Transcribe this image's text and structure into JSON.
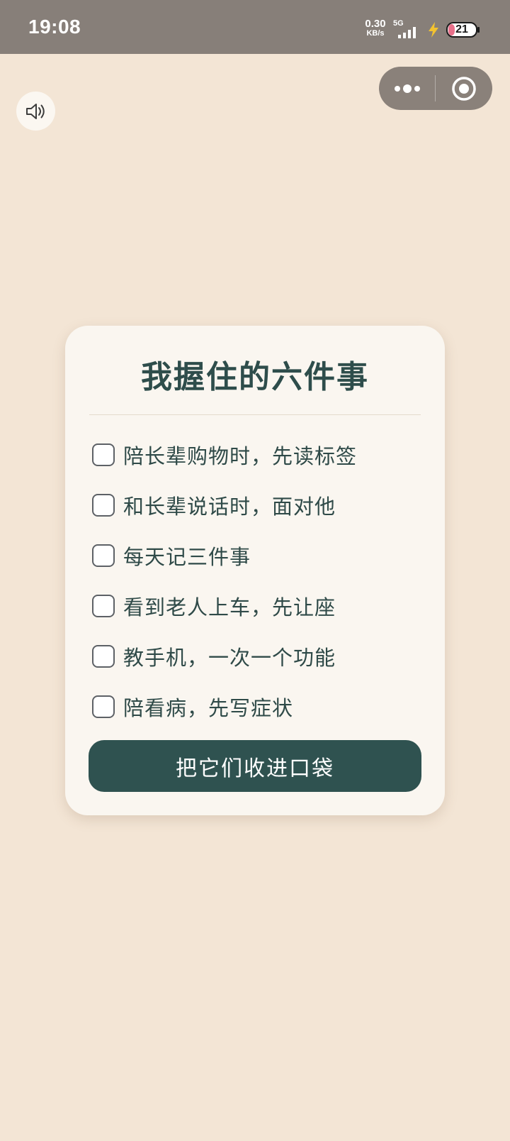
{
  "status_bar": {
    "time": "19:08",
    "net_speed_value": "0.30",
    "net_speed_unit": "KB/s",
    "network_type": "5G",
    "battery_level": "21"
  },
  "toolbar": {
    "sound_icon": "speaker-icon",
    "more_icon": "more-dots-icon",
    "close_icon": "target-circle-icon"
  },
  "card": {
    "title": "我握住的六件事",
    "items": [
      {
        "label": "陪长辈购物时，先读标签",
        "checked": false
      },
      {
        "label": "和长辈说话时，面对他",
        "checked": false
      },
      {
        "label": "每天记三件事",
        "checked": false
      },
      {
        "label": "看到老人上车，先让座",
        "checked": false
      },
      {
        "label": "教手机，一次一个功能",
        "checked": false
      },
      {
        "label": "陪看病，先写症状",
        "checked": false
      }
    ],
    "button_label": "把它们收进口袋"
  },
  "colors": {
    "background": "#f3e5d5",
    "status_bar": "#877f79",
    "card": "#faf6f0",
    "accent": "#2f5250",
    "text": "#2f4a48"
  }
}
